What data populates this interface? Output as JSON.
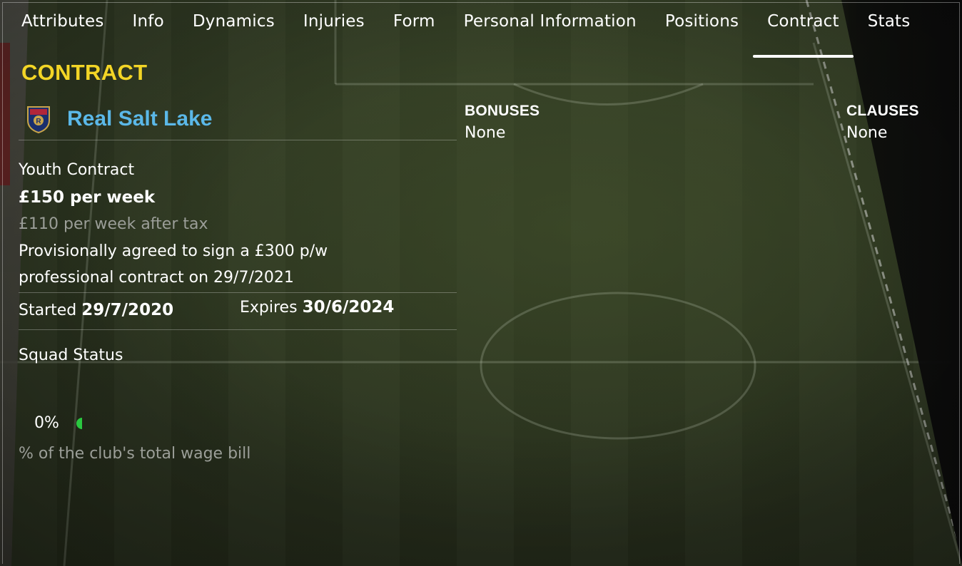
{
  "tabs": [
    {
      "label": "Attributes"
    },
    {
      "label": "Info"
    },
    {
      "label": "Dynamics"
    },
    {
      "label": "Injuries"
    },
    {
      "label": "Form"
    },
    {
      "label": "Personal Information"
    },
    {
      "label": "Positions"
    },
    {
      "label": "Contract"
    },
    {
      "label": "Stats"
    }
  ],
  "active_tab": "Contract",
  "section_title": "CONTRACT",
  "club": {
    "name": "Real Salt Lake",
    "crest_icon": "real-salt-lake-crest-icon"
  },
  "contract": {
    "type": "Youth Contract",
    "wage": "£150 per week",
    "wage_after_tax": "£110 per week after tax",
    "provisional_line1": "Provisionally agreed to sign a £300 p/w",
    "provisional_line2": "professional contract on 29/7/2021",
    "started_label": "Started",
    "started_value": "29/7/2020",
    "expires_label": "Expires",
    "expires_value": "30/6/2024"
  },
  "squad_status": {
    "label": "Squad Status"
  },
  "wage_share": {
    "percent_text": "0%",
    "percent": 0,
    "note": "% of the club's total wage bill"
  },
  "bonuses": {
    "title": "BONUSES",
    "value": "None"
  },
  "clauses": {
    "title": "CLAUSES",
    "value": "None"
  },
  "colors": {
    "section_title": "#f3d526",
    "club_name": "#5bb8e8",
    "dim_text": "#9b9e98",
    "wage_bar": "#2ac840"
  }
}
